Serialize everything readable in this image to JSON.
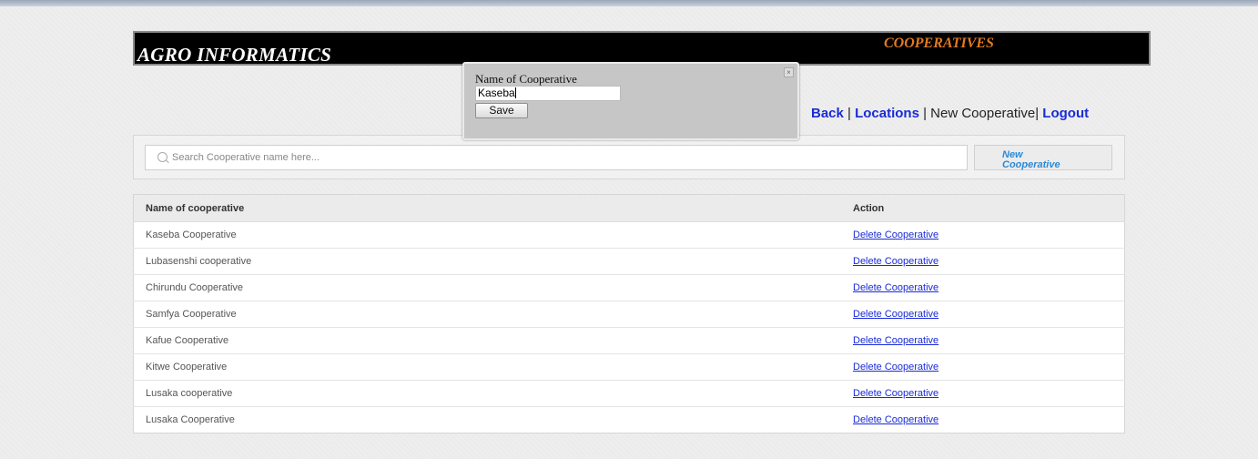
{
  "header": {
    "brand": "AGRO INFORMATICS",
    "section": "COOPERATIVES"
  },
  "nav": {
    "back": "Back",
    "sep1": " | ",
    "locations": "Locations",
    "sep2": " | ",
    "current": "New Cooperative|",
    "sep3": " ",
    "logout": "Logout"
  },
  "search": {
    "placeholder": "Search Cooperative name here...",
    "new_button": "New Cooperative"
  },
  "table": {
    "headers": [
      "Name of cooperative",
      "Action"
    ],
    "rows": [
      {
        "name": "Kaseba Cooperative",
        "action": "Delete Cooperative"
      },
      {
        "name": "Lubasenshi cooperative",
        "action": "Delete Cooperative"
      },
      {
        "name": "Chirundu Cooperative",
        "action": "Delete Cooperative"
      },
      {
        "name": "Samfya Cooperative",
        "action": "Delete Cooperative"
      },
      {
        "name": "Kafue Cooperative",
        "action": "Delete Cooperative"
      },
      {
        "name": "Kitwe Cooperative",
        "action": "Delete Cooperative"
      },
      {
        "name": "Lusaka cooperative",
        "action": "Delete Cooperative"
      },
      {
        "name": "Lusaka Cooperative",
        "action": "Delete Cooperative"
      }
    ]
  },
  "modal": {
    "label": "Name of Cooperative",
    "value": "Kaseba",
    "save": "Save",
    "close": "×"
  },
  "colors": {
    "header_bg": "#000000",
    "section_title": "#e07a20",
    "link": "#1a2bd6",
    "new_button_text": "#2a8ad8"
  }
}
